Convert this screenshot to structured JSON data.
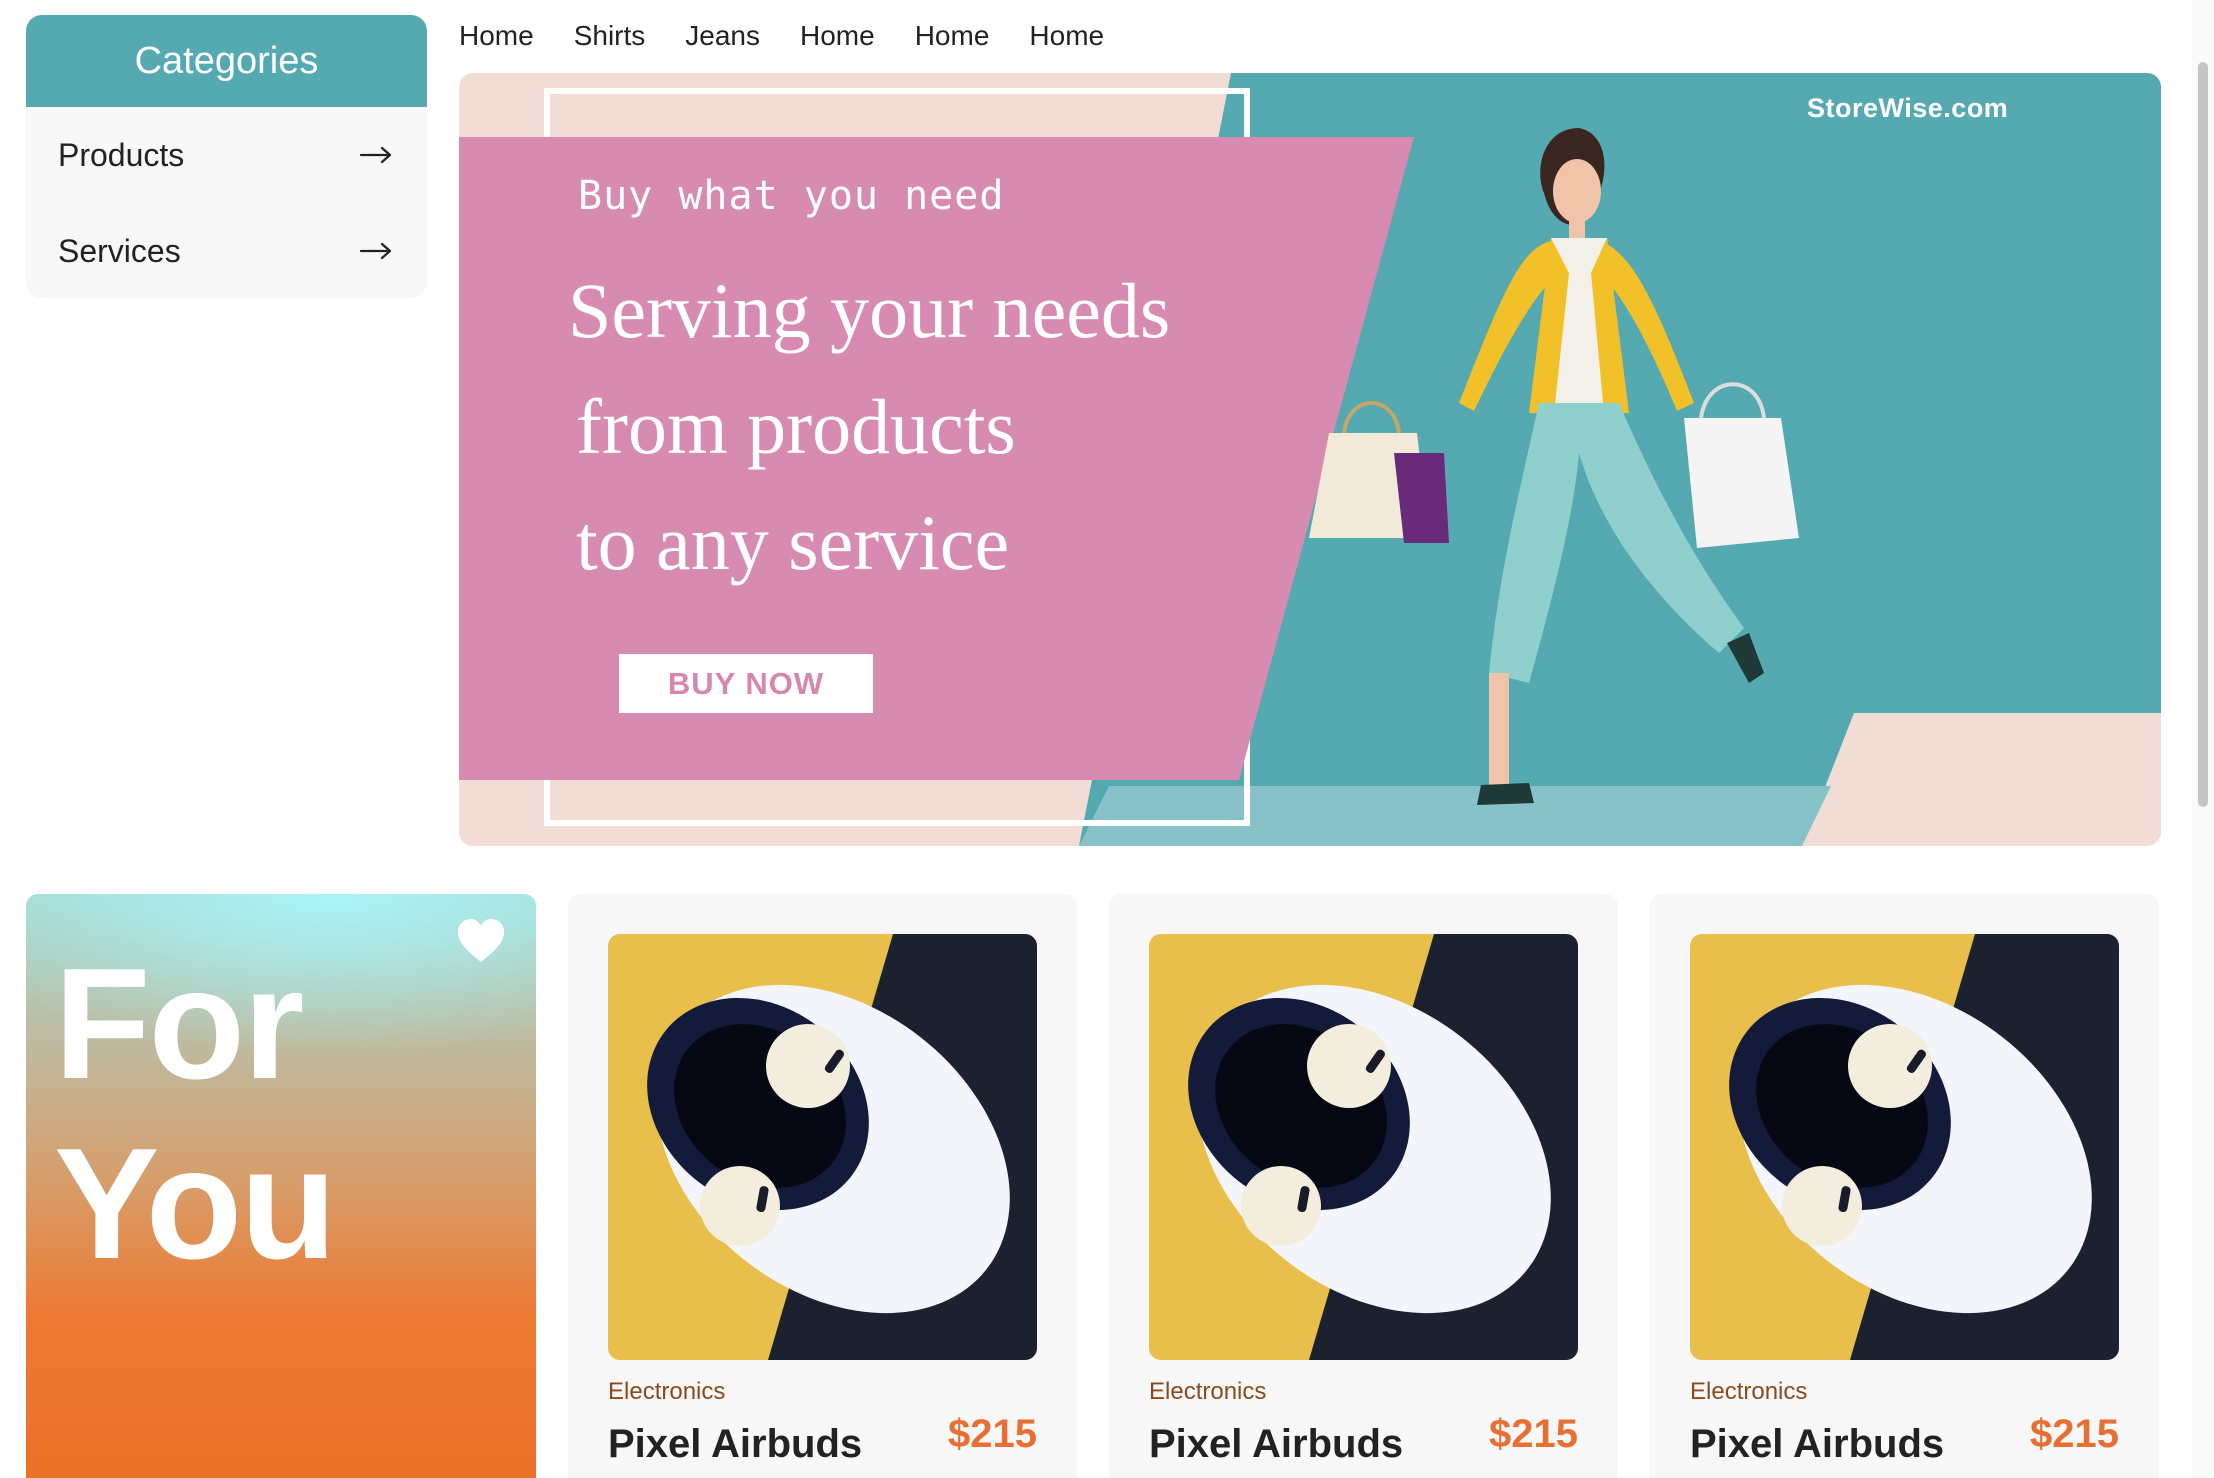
{
  "sidebar": {
    "header": "Categories",
    "items": [
      {
        "label": "Products",
        "icon": "arrow-right-icon"
      },
      {
        "label": "Services",
        "icon": "arrow-right-icon"
      }
    ]
  },
  "nav": {
    "links": [
      "Home",
      "Shirts",
      "Jeans",
      "Home",
      "Home",
      "Home"
    ]
  },
  "banner": {
    "site": "StoreWise.com",
    "tagline": "Buy what you need",
    "headline": [
      "Serving your needs",
      "from products",
      "to any service"
    ],
    "button": "BUY NOW",
    "colors": {
      "pink": "#d88bb0",
      "teal": "#55aab1",
      "blush": "#f1ddd6"
    }
  },
  "foryou": {
    "line1": "For",
    "line2": "You",
    "icon": "heart-icon"
  },
  "products": [
    {
      "category": "Electronics",
      "name": "Pixel Airbuds",
      "price": "$215"
    },
    {
      "category": "Electronics",
      "name": "Pixel Airbuds",
      "price": "$215"
    },
    {
      "category": "Electronics",
      "name": "Pixel Airbuds",
      "price": "$215"
    }
  ]
}
